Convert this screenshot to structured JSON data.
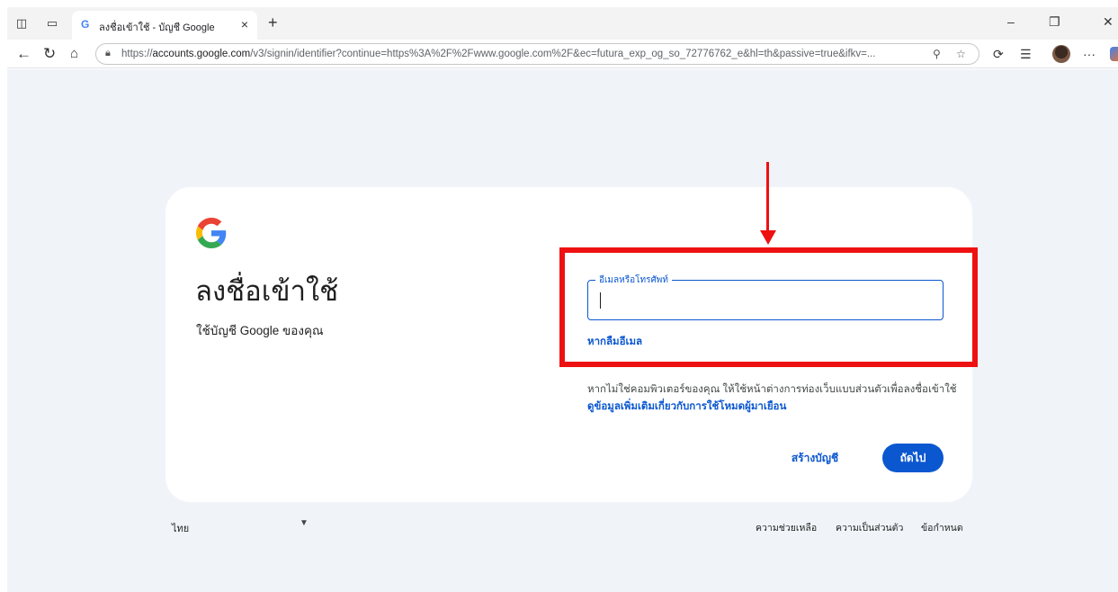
{
  "browser": {
    "tab": {
      "title": "ลงชื่อเข้าใช้ - บัญชี Google",
      "favicon": "google-g-icon"
    },
    "address_bar": {
      "url_prefix": "https://",
      "url_host": "accounts.google.com",
      "url_rest": "/v3/signin/identifier?continue=https%3A%2F%2Fwww.google.com%2F&ec=futura_exp_og_so_72776762_e&hl=th&passive=true&ifkv=..."
    }
  },
  "signin": {
    "title": "ลงชื่อเข้าใช้",
    "subtitle": "ใช้บัญชี Google ของคุณ",
    "email_field": {
      "label": "อีเมลหรือโทรศัพท์",
      "value": ""
    },
    "forgot_email": "หากลืมอีเมล",
    "guest_notice": "หากไม่ใช่คอมพิวเตอร์ของคุณ ให้ใช้หน้าต่างการท่องเว็บแบบส่วนตัวเพื่อลงชื่อเข้าใช้",
    "guest_link": "ดูข้อมูลเพิ่มเติมเกี่ยวกับการใช้โหมดผู้มาเยือน",
    "create_account": "สร้างบัญชี",
    "next": "ถัดไป"
  },
  "footer": {
    "language": "ไทย",
    "help": "ความช่วยเหลือ",
    "privacy": "ความเป็นส่วนตัว",
    "terms": "ข้อกำหนด"
  },
  "colors": {
    "accent": "#0b57d0",
    "page_bg": "#f0f4f9",
    "annotation": "#ee1111"
  }
}
